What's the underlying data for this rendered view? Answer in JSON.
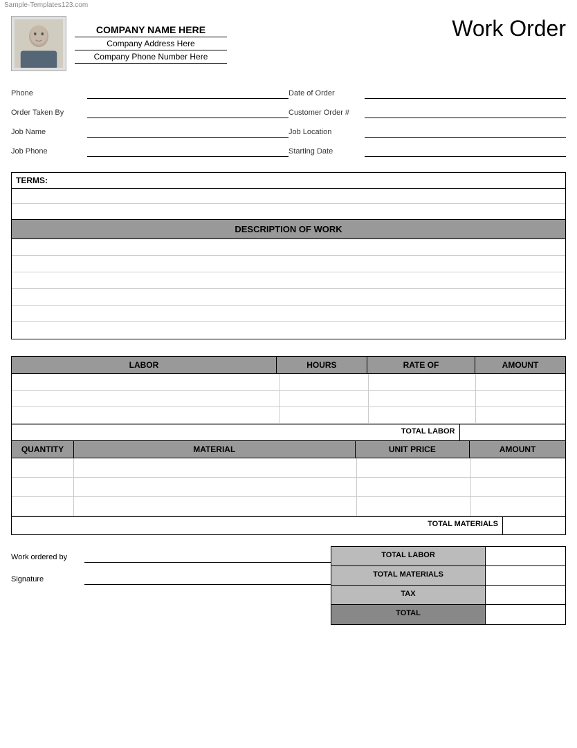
{
  "watermark": "Sample-Templates123.com",
  "header": {
    "company_name": "COMPANY NAME HERE",
    "company_address": "Company Address Here",
    "company_phone": "Company Phone Number Here",
    "title": "Work Order"
  },
  "form": {
    "left": {
      "phone_label": "Phone",
      "order_taken_label": "Order Taken By",
      "job_name_label": "Job Name",
      "job_phone_label": "Job Phone"
    },
    "right": {
      "date_label": "Date of Order",
      "customer_order_label": "Customer Order #",
      "job_location_label": "Job Location",
      "starting_date_label": "Starting Date"
    }
  },
  "terms": {
    "header": "TERMS:"
  },
  "description": {
    "header": "DESCRIPTION OF WORK"
  },
  "labor": {
    "col_labor": "LABOR",
    "col_hours": "HOURS",
    "col_rate": "RATE OF",
    "col_amount": "AMOUNT",
    "total_label": "TOTAL LABOR",
    "rows": 3
  },
  "materials": {
    "col_qty": "QUANTITY",
    "col_material": "MATERIAL",
    "col_unit": "UNIT PRICE",
    "col_amount": "AMOUNT",
    "total_label": "TOTAL MATERIALS",
    "rows": 3
  },
  "footer": {
    "work_ordered_label": "Work ordered by",
    "signature_label": "Signature",
    "summary": {
      "total_labor": "TOTAL LABOR",
      "total_materials": "TOTAL MATERIALS",
      "tax": "TAX",
      "total": "TOTAL"
    }
  }
}
